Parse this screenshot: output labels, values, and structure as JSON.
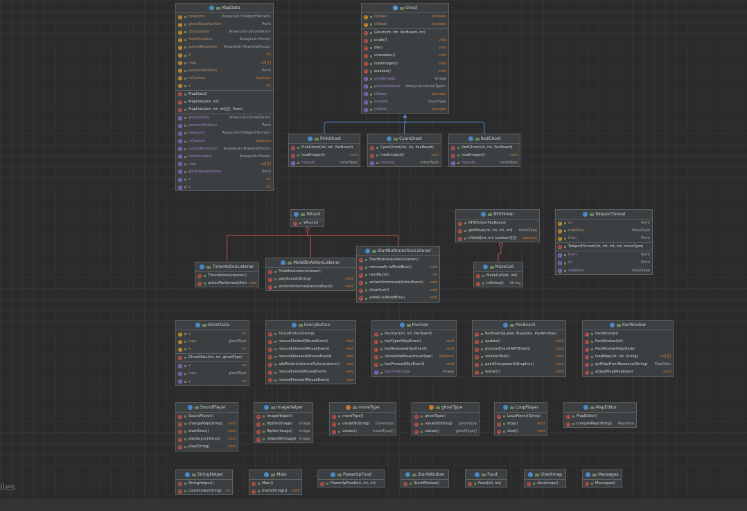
{
  "classes": [
    {
      "id": "MapData",
      "title": "MapData",
      "icon": "class",
      "sections": [
        [
          [
            "teleports",
            "f",
            "AreayList<TeleportTunnel>"
          ],
          [
            "ghostBasePosition",
            "f",
            "Point"
          ],
          [
            "ghostsData",
            "f",
            "AreayList<GhostData>"
          ],
          [
            "foodPositions",
            "f",
            "AreayList<Food>"
          ],
          [
            "pufoodPositions",
            "f",
            "AreayList<PowerUpFood>"
          ],
          [
            "y",
            "f",
            "int"
          ],
          [
            "map",
            "f",
            "int[][]"
          ],
          [
            "pacmanPosition",
            "f",
            "Point"
          ],
          [
            "isCustom",
            "f",
            "boolean"
          ],
          [
            "x",
            "f",
            "int"
          ]
        ],
        [
          [
            "MapData()",
            "m",
            ""
          ],
          [
            "MapData(int, int)",
            "m",
            ""
          ],
          [
            "MapData(int, int, int[][], Point)",
            "m",
            ""
          ]
        ],
        [
          [
            "ghostsData",
            "p",
            "AreayList<GhostData>"
          ],
          [
            "pacmanPosition",
            "p",
            "Point"
          ],
          [
            "teleports",
            "p",
            "AreayList<TeleportTunnel>"
          ],
          [
            "isCustom",
            "p",
            "boolean"
          ],
          [
            "pufoodPositions",
            "p",
            "AreayList<PowerUpFood>"
          ],
          [
            "foodPositions",
            "p",
            "AreayList<Food>"
          ],
          [
            "map",
            "p",
            "int[][]"
          ],
          [
            "ghostBasePosition",
            "p",
            "Point"
          ],
          [
            "x",
            "p",
            "int"
          ],
          [
            "y",
            "p",
            "int"
          ]
        ]
      ]
    },
    {
      "id": "Ghost",
      "title": "Ghost",
      "icon": "abstract",
      "sections": [
        [
          [
            "isDead",
            "f",
            "boolean"
          ],
          [
            "isWeak",
            "f",
            "boolean"
          ]
        ],
        [
          [
            "Ghost(int, int, PacBoard, int)",
            "m",
            ""
          ],
          [
            "undie()",
            "m",
            "void"
          ],
          [
            "die()",
            "m",
            "void"
          ],
          [
            "unweaken()",
            "m",
            "void"
          ],
          [
            "loadImages()",
            "m",
            "void"
          ],
          [
            "weaken()",
            "m",
            "void"
          ],
          [
            "ghostImage",
            "p",
            "Image"
          ],
          [
            "possibleMoves",
            "p",
            "AreayList<moveType>"
          ],
          [
            "isDead",
            "p",
            "boolean"
          ],
          [
            "moveAI",
            "p",
            "moveType"
          ],
          [
            "isWeak",
            "p",
            "boolean"
          ]
        ]
      ]
    },
    {
      "id": "PinkGhost",
      "title": "PinkGhost",
      "icon": "class",
      "sections": [
        [
          [
            "PinkGhost(int, int, PacBoard)",
            "m",
            ""
          ],
          [
            "loadImages()",
            "m",
            "void"
          ],
          [
            "moveAI",
            "p",
            "moveType"
          ]
        ]
      ]
    },
    {
      "id": "CyanGhost",
      "title": "CyanGhost",
      "icon": "class",
      "sections": [
        [
          [
            "CyanGhost(int, int, PacBoard)",
            "m",
            ""
          ],
          [
            "loadImages()",
            "m",
            "void"
          ],
          [
            "moveAI",
            "p",
            "moveType"
          ]
        ]
      ]
    },
    {
      "id": "RedGhost",
      "title": "RedGhost",
      "icon": "class",
      "sections": [
        [
          [
            "RedGhost(int, int, PacBoard)",
            "m",
            ""
          ],
          [
            "loadImages()",
            "m",
            "void"
          ],
          [
            "moveAI",
            "p",
            "moveType"
          ]
        ]
      ]
    },
    {
      "id": "Whack",
      "title": "Whack",
      "icon": "class",
      "sections": [
        [
          [
            "Whack()",
            "m",
            ""
          ]
        ]
      ]
    },
    {
      "id": "BFSFinder",
      "title": "BFSFinder",
      "icon": "class",
      "sections": [
        [
          [
            "BFSFinder(PacBoard)",
            "m",
            ""
          ],
          [
            "getMove(int, int, int, int)",
            "m",
            "moveType"
          ],
          [
            "isValid(int, int, boolean[][])",
            "m",
            "boolean"
          ]
        ]
      ]
    },
    {
      "id": "TeleportTunnel",
      "title": "TeleportTunnel",
      "icon": "class",
      "sections": [
        [
          [
            "to",
            "f",
            "Point"
          ],
          [
            "reqMove",
            "f",
            "moveType"
          ],
          [
            "from",
            "f",
            "Point"
          ]
        ],
        [
          [
            "TeleportTunnel(int, int, int, int, moveType)",
            "m",
            ""
          ]
        ],
        [
          [
            "from",
            "p",
            "Point"
          ],
          [
            "to",
            "p",
            "Point"
          ],
          [
            "reqMove",
            "p",
            "moveType"
          ]
        ]
      ]
    },
    {
      "id": "TimerActionListener",
      "title": "TimerActionListener",
      "icon": "class",
      "sections": [
        [
          [
            "TimerActionListener()",
            "m",
            ""
          ],
          [
            "actionPerformed(ActionEvent)",
            "m",
            "void"
          ]
        ]
      ]
    },
    {
      "id": "MoleBtnActionListener",
      "title": "MoleBtnActionListener",
      "icon": "class",
      "sections": [
        [
          [
            "MoleBtnActionListener()",
            "m",
            ""
          ],
          [
            "playSound(String)",
            "m",
            "void"
          ],
          [
            "actionPerformed(ActionEvent)",
            "m",
            "void"
          ]
        ]
      ]
    },
    {
      "id": "StartButtonActionListener",
      "title": "StartButtonActionListener",
      "icon": "class",
      "sections": [
        [
          [
            "StartButtonActionListener()",
            "m",
            ""
          ],
          [
            "removeAL-toMoleBtns()",
            "m",
            "void"
          ],
          [
            "randNum()",
            "m",
            "int"
          ],
          [
            "actionPerformed(ActionEvent)",
            "m",
            "void"
          ],
          [
            "showIcon()",
            "m",
            "void"
          ],
          [
            "addAL-toMoleBtns()",
            "m",
            "void"
          ]
        ]
      ]
    },
    {
      "id": "MazeCell",
      "title": "MazeCell",
      "icon": "class",
      "sections": [
        [
          [
            "MazeCell(int, int)",
            "m",
            ""
          ],
          [
            "toString()",
            "m",
            "String"
          ]
        ]
      ]
    },
    {
      "id": "GhostData",
      "title": "GhostData",
      "icon": "class",
      "sections": [
        [
          [
            "y",
            "f",
            "int"
          ],
          [
            "type",
            "f",
            "ghostType"
          ],
          [
            "x",
            "f",
            "int"
          ]
        ],
        [
          [
            "GhostData(int, int, ghostType)",
            "m",
            ""
          ]
        ],
        [
          [
            "x",
            "p",
            "int"
          ],
          [
            "type",
            "p",
            "ghostType"
          ],
          [
            "y",
            "p",
            "int"
          ]
        ]
      ]
    },
    {
      "id": "FancyButton",
      "title": "FancyButton",
      "icon": "class",
      "sections": [
        [
          [
            "FancyButton(String)",
            "m",
            ""
          ],
          [
            "mouseClicked(MouseEvent)",
            "m",
            "void"
          ],
          [
            "mouseEntered(MouseEvent)",
            "m",
            "void"
          ],
          [
            "mouseReleased(MouseEvent)",
            "m",
            "void"
          ],
          [
            "addActionListener(ActionListener)",
            "m",
            "void"
          ],
          [
            "mouseExited(MouseEvent)",
            "m",
            "void"
          ],
          [
            "mousePressed(MouseEvent)",
            "m",
            "void"
          ]
        ]
      ]
    },
    {
      "id": "Pacman",
      "title": "Pacman",
      "icon": "class",
      "sections": [
        [
          [
            "Pacman(int, int, PacBoard)",
            "m",
            ""
          ],
          [
            "keyTyped(KeyEvent)",
            "m",
            "void"
          ],
          [
            "keyReleased(KeyEvent)",
            "m",
            "void"
          ],
          [
            "isPossibleMove(moveType)",
            "m",
            "boolean"
          ],
          [
            "keyPressed(KeyEvent)",
            "m",
            "void"
          ],
          [
            "pacmanImage",
            "p",
            "Image"
          ]
        ]
      ]
    },
    {
      "id": "PacBoard",
      "title": "PacBoard",
      "icon": "class",
      "sections": [
        [
          [
            "PacBoard(JLabel, MapData, PacWindow)",
            "m",
            ""
          ],
          [
            "update()",
            "m",
            "void"
          ],
          [
            "processEvent(AWTEvent)",
            "m",
            "void"
          ],
          [
            "collisionTest()",
            "m",
            "void"
          ],
          [
            "paintComponent(Graphics)",
            "m",
            "void"
          ],
          [
            "restart()",
            "m",
            "void"
          ]
        ]
      ]
    },
    {
      "id": "PacWindow",
      "title": "PacWindow",
      "icon": "class",
      "sections": [
        [
          [
            "PacWindow()",
            "m",
            ""
          ],
          [
            "PacWindow(int)",
            "m",
            ""
          ],
          [
            "PacWindow(MapData)",
            "m",
            ""
          ],
          [
            "loadMap(int, int, String)",
            "m",
            "int[][]"
          ],
          [
            "getMapFromResource(String)",
            "m",
            "MapData"
          ],
          [
            "adjustMap(MapData)",
            "m",
            "void"
          ]
        ]
      ]
    },
    {
      "id": "SoundPlayer",
      "title": "SoundPlayer",
      "icon": "class",
      "sections": [
        [
          [
            "SoundPlayer()",
            "m",
            ""
          ],
          [
            "changeMap(String)",
            "m",
            "void"
          ],
          [
            "startSiren()",
            "m",
            "void"
          ],
          [
            "playAsync(String)",
            "m",
            "void"
          ],
          [
            "play(String)",
            "m",
            "void"
          ]
        ]
      ]
    },
    {
      "id": "ImageHelper",
      "title": "ImageHelper",
      "icon": "class",
      "sections": [
        [
          [
            "ImageHelper()",
            "m",
            ""
          ],
          [
            "flipHor(Image)",
            "m",
            "Image"
          ],
          [
            "flipVer(Image)",
            "m",
            "Image"
          ],
          [
            "rotate90(Image)",
            "m",
            "Image"
          ]
        ]
      ]
    },
    {
      "id": "moveType",
      "title": "moveType",
      "icon": "enum",
      "sections": [
        [
          [
            "moveType()",
            "m",
            ""
          ],
          [
            "valueOf(String)",
            "m",
            "moveType"
          ],
          [
            "values()",
            "m",
            "moveType[]"
          ]
        ]
      ]
    },
    {
      "id": "ghostType",
      "title": "ghostType",
      "icon": "enum",
      "sections": [
        [
          [
            "ghostType()",
            "m",
            ""
          ],
          [
            "valueOf(String)",
            "m",
            "ghostType"
          ],
          [
            "values()",
            "m",
            "ghostType[]"
          ]
        ]
      ]
    },
    {
      "id": "LoopPlayer",
      "title": "LoopPlayer",
      "icon": "class",
      "sections": [
        [
          [
            "LoopPlayer(String)",
            "m",
            ""
          ],
          [
            "stop()",
            "m",
            "void"
          ],
          [
            "start()",
            "m",
            "void"
          ]
        ]
      ]
    },
    {
      "id": "MapEditor",
      "title": "MapEditor",
      "icon": "class",
      "sections": [
        [
          [
            "MapEditor()",
            "m",
            ""
          ],
          [
            "compileMap(String)",
            "m",
            "MapData"
          ]
        ]
      ]
    },
    {
      "id": "StringHelper",
      "title": "StringHelper",
      "icon": "class",
      "sections": [
        [
          [
            "StringHelper()",
            "m",
            ""
          ],
          [
            "countLines(String)",
            "m",
            "int"
          ]
        ]
      ]
    },
    {
      "id": "Main",
      "title": "Main",
      "icon": "class",
      "sections": [
        [
          [
            "Main()",
            "m",
            ""
          ],
          [
            "main(String[])",
            "m",
            "void"
          ]
        ]
      ]
    },
    {
      "id": "PowerUpFood",
      "title": "PowerUpFood",
      "icon": "class",
      "sections": [
        [
          [
            "PowerUpFood(int, int, int)",
            "m",
            ""
          ]
        ]
      ]
    },
    {
      "id": "StartWindow",
      "title": "StartWindow",
      "icon": "class",
      "sections": [
        [
          [
            "StartWindow()",
            "m",
            ""
          ]
        ]
      ]
    },
    {
      "id": "Food",
      "title": "Food",
      "icon": "class",
      "sections": [
        [
          [
            "Food(int, int)",
            "m",
            ""
          ]
        ]
      ]
    },
    {
      "id": "checkmap",
      "title": "checkmap",
      "icon": "class",
      "sections": [
        [
          [
            "checkmap()",
            "m",
            ""
          ]
        ]
      ]
    },
    {
      "id": "Messeges",
      "title": "Messeges",
      "icon": "class",
      "sections": [
        [
          [
            "Messeges()",
            "m",
            ""
          ]
        ]
      ]
    }
  ],
  "colors": {
    "inheritance": "#4a88c7",
    "inner": "#c75450"
  },
  "panel_label": "iles"
}
